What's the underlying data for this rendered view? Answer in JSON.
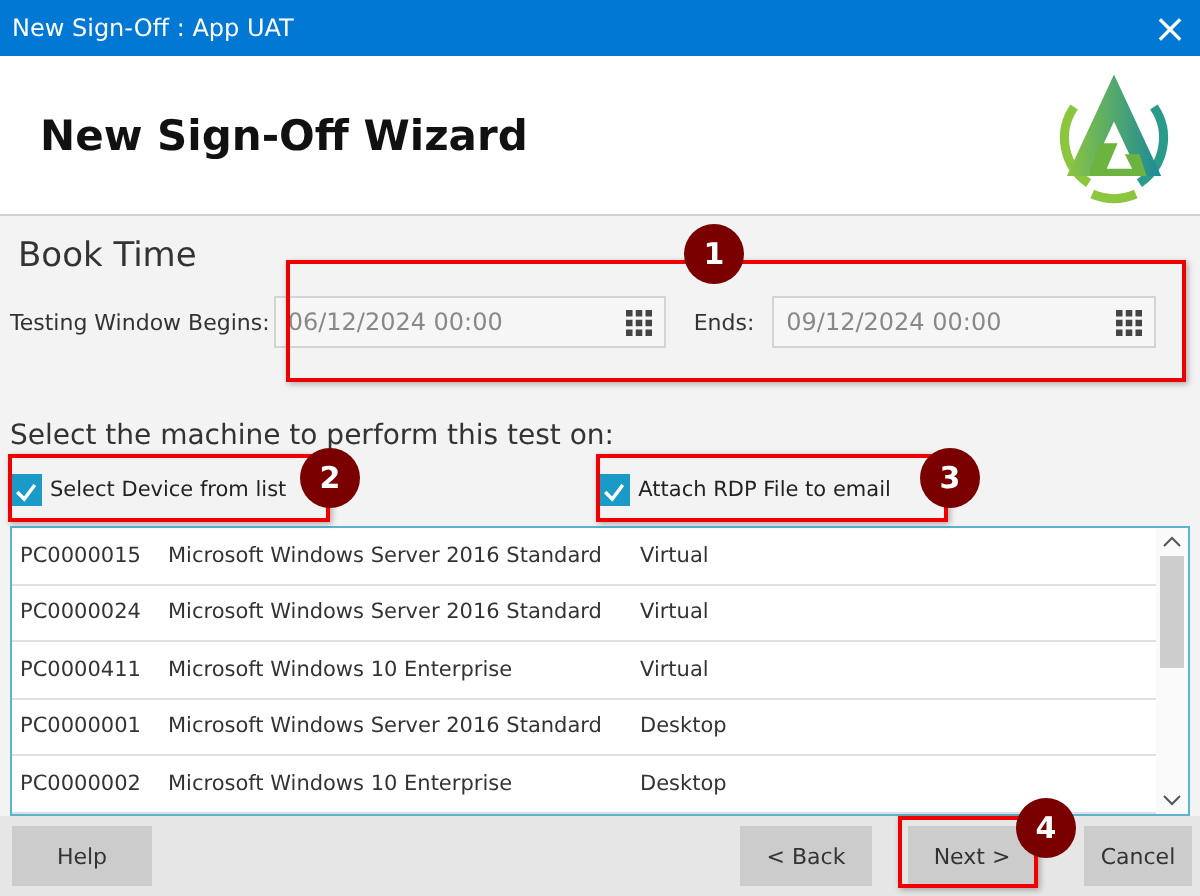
{
  "window": {
    "title": "New Sign-Off : App UAT",
    "close": "×"
  },
  "header": {
    "title": "New Sign-Off Wizard"
  },
  "section": {
    "title": "Book Time",
    "begins_label": "Testing Window Begins:",
    "begins_value": "06/12/2024 00:00",
    "ends_label": "Ends:",
    "ends_value": "09/12/2024 00:00"
  },
  "prompt": "Select the machine to perform this test on:",
  "options": [
    {
      "label": "Select Device from list",
      "checked": true
    },
    {
      "label": "Attach RDP File to email",
      "checked": true
    }
  ],
  "machines": [
    {
      "id": "PC0000015",
      "os": "Microsoft Windows Server 2016 Standard",
      "type": "Virtual"
    },
    {
      "id": "PC0000024",
      "os": "Microsoft Windows Server 2016 Standard",
      "type": "Virtual"
    },
    {
      "id": "PC0000411",
      "os": "Microsoft Windows 10 Enterprise",
      "type": "Virtual"
    },
    {
      "id": "PC0000001",
      "os": "Microsoft Windows Server 2016 Standard",
      "type": "Desktop"
    },
    {
      "id": "PC0000002",
      "os": "Microsoft Windows 10 Enterprise",
      "type": "Desktop"
    }
  ],
  "buttons": {
    "help": "Help",
    "back": "< Back",
    "next": "Next >",
    "cancel": "Cancel"
  },
  "annotations": [
    {
      "number": "1"
    },
    {
      "number": "2"
    },
    {
      "number": "3"
    },
    {
      "number": "4"
    }
  ]
}
